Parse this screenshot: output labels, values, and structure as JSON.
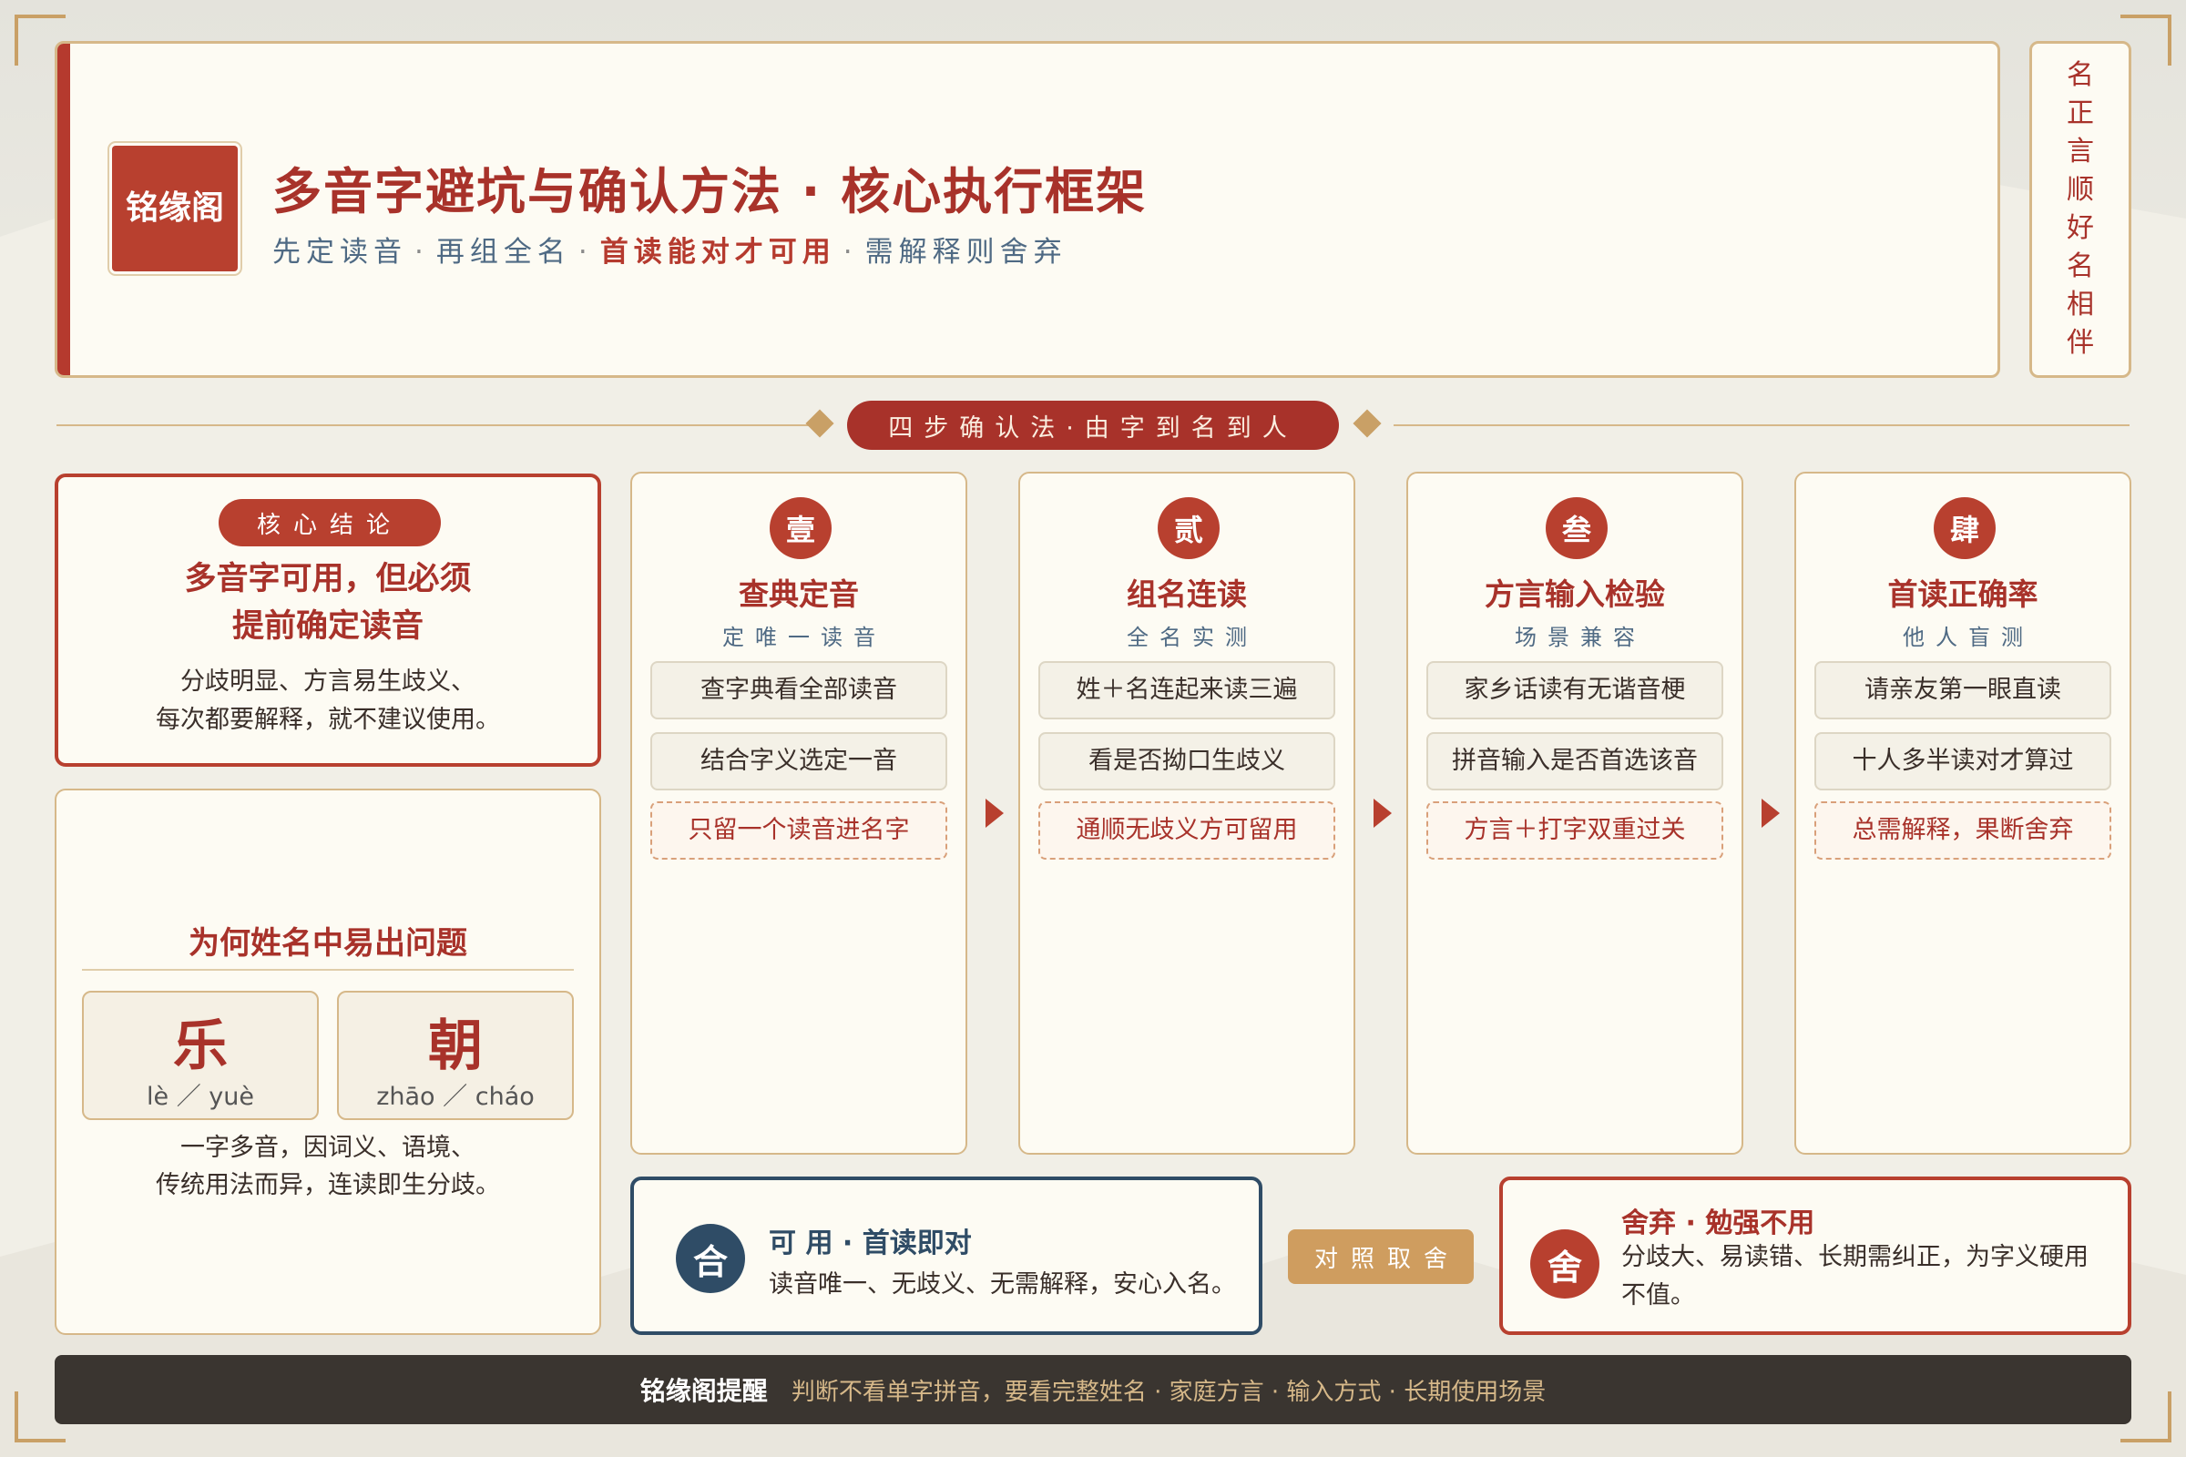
{
  "header": {
    "seal_text": "铭缘阁",
    "title": "多音字避坑与确认方法 · 核心执行框架",
    "subtitle": {
      "part1": "先定读音",
      "sep": "·",
      "part2": "再组全名",
      "part3": "首读能对才可用",
      "part4": "需解释则舍弃"
    },
    "vertical_motto": [
      "名",
      "正",
      "言",
      "顺",
      "好",
      "名",
      "相",
      "伴"
    ]
  },
  "section": {
    "label": "四步确认法·由字到名到人"
  },
  "core": {
    "badge": "核心结论",
    "headline_line1": "多音字可用，但必须",
    "headline_line2": "提前确定读音",
    "body_line1": "分歧明显、方言易生歧义、",
    "body_line2": "每次都要解释，就不建议使用。"
  },
  "why": {
    "title": "为何姓名中易出问题",
    "examples": [
      {
        "char": "乐",
        "pinyin": "lè ／ yuè"
      },
      {
        "char": "朝",
        "pinyin": "zhāo ／ cháo"
      }
    ],
    "body_line1": "一字多音，因词义、语境、",
    "body_line2": "传统用法而异，连读即生分歧。"
  },
  "steps": [
    {
      "num": "壹",
      "title": "查典定音",
      "subtitle": "定唯一读音",
      "items": [
        "查字典看全部读音",
        "结合字义选定一音"
      ],
      "highlight": "只留一个读音进名字"
    },
    {
      "num": "贰",
      "title": "组名连读",
      "subtitle": "全名实测",
      "items": [
        "姓＋名连起来读三遍",
        "看是否拗口生歧义"
      ],
      "highlight": "通顺无歧义方可留用"
    },
    {
      "num": "叁",
      "title": "方言输入检验",
      "subtitle": "场景兼容",
      "items": [
        "家乡话读有无谐音梗",
        "拼音输入是否首选该音"
      ],
      "highlight": "方言＋打字双重过关"
    },
    {
      "num": "肆",
      "title": "首读正确率",
      "subtitle": "他人盲测",
      "items": [
        "请亲友第一眼直读",
        "十人多半读对才算过"
      ],
      "highlight": "总需解释，果断舍弃"
    }
  ],
  "compare": {
    "ok": {
      "symbol": "合",
      "title": "可 用 · 首读即对",
      "desc": "读音唯一、无歧义、无需解释，安心入名。"
    },
    "label": "对照取舍",
    "no": {
      "symbol": "舍",
      "title": "舍弃 · 勉强不用",
      "desc": "分歧大、易读错、长期需纠正，为字义硬用不值。"
    }
  },
  "footer": {
    "brand": "铭缘阁提醒",
    "message": "判断不看单字拼音，要看完整姓名 · 家庭方言 · 输入方式 · 长期使用场景"
  },
  "colors": {
    "accent_red": "#b8402f",
    "navy": "#2f4c66",
    "gold": "#c9a066",
    "paper": "#fdfbf3"
  }
}
